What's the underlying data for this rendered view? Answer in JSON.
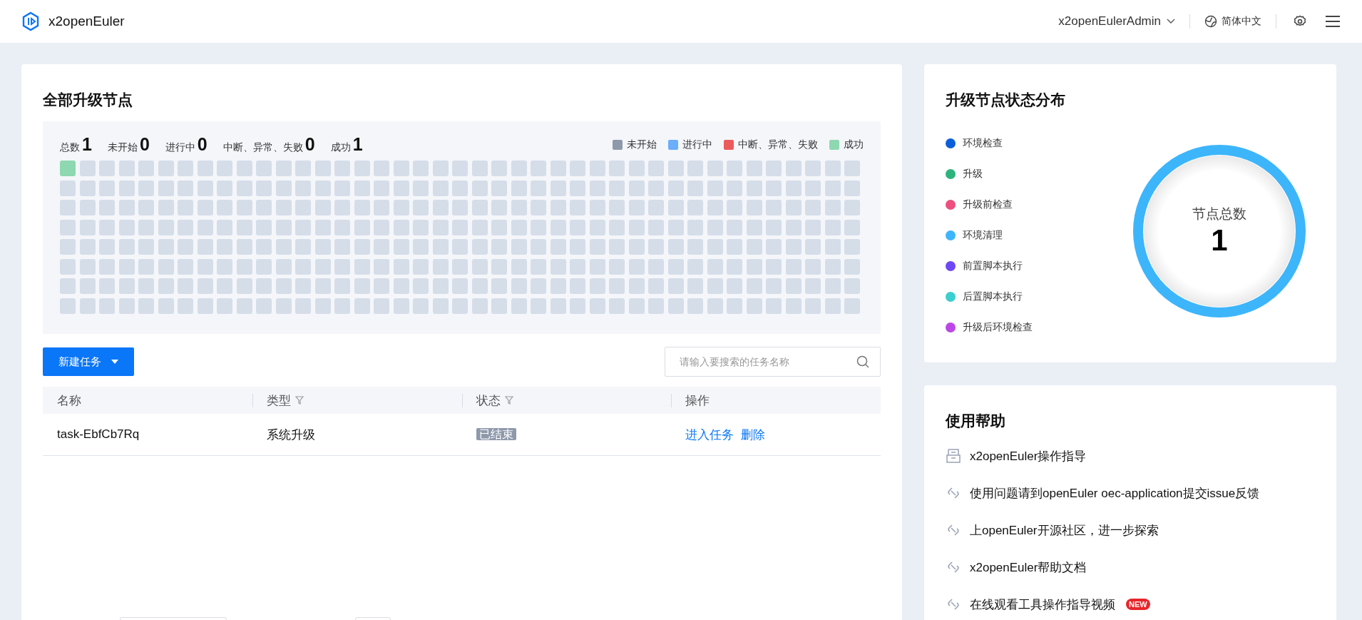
{
  "header": {
    "app_name": "x2openEuler",
    "user": "x2openEulerAdmin",
    "language": "简体中文"
  },
  "nodes_panel": {
    "title": "全部升级节点",
    "stats": [
      {
        "label": "总数",
        "value": "1"
      },
      {
        "label": "未开始",
        "value": "0"
      },
      {
        "label": "进行中",
        "value": "0"
      },
      {
        "label": "中断、异常、失败",
        "value": "0"
      },
      {
        "label": "成功",
        "value": "1"
      }
    ],
    "legend": [
      {
        "label": "未开始",
        "color": "#8e99ab"
      },
      {
        "label": "进行中",
        "color": "#6aaefc"
      },
      {
        "label": "中断、异常、失败",
        "color": "#ec5b5b"
      },
      {
        "label": "成功",
        "color": "#8dd8b0"
      }
    ],
    "nodes": [
      {
        "color": "#8dd8b0"
      }
    ]
  },
  "toolbar": {
    "new_task_button": "新建任务",
    "search": {
      "placeholder": "请输入要搜索的任务名称"
    }
  },
  "table": {
    "columns": [
      {
        "label": "名称",
        "filter": false
      },
      {
        "label": "类型",
        "filter": true
      },
      {
        "label": "状态",
        "filter": true
      },
      {
        "label": "操作",
        "filter": false
      }
    ],
    "rows": [
      {
        "name": "task-EbfCb7Rq",
        "type": "系统升级",
        "status": "已结束",
        "actions": [
          "进入任务",
          "删除"
        ]
      }
    ]
  },
  "status_panel": {
    "title": "升级节点状态分布",
    "legend": [
      {
        "label": "环境检查",
        "color": "#0b5fd8"
      },
      {
        "label": "升级",
        "color": "#2db37c"
      },
      {
        "label": "升级前检查",
        "color": "#ec4f80"
      },
      {
        "label": "环境清理",
        "color": "#3db5fb"
      },
      {
        "label": "前置脚本执行",
        "color": "#6d48f4"
      },
      {
        "label": "后置脚本执行",
        "color": "#3ccfcf"
      },
      {
        "label": "升级后环境检查",
        "color": "#bd47e6"
      }
    ],
    "center_label": "节点总数",
    "center_value": "1"
  },
  "help_panel": {
    "title": "使用帮助",
    "items": [
      {
        "kind": "doc",
        "text": "x2openEuler操作指导",
        "new": false
      },
      {
        "kind": "link",
        "text": "使用问题请到openEuler oec-application提交issue反馈",
        "new": false
      },
      {
        "kind": "link",
        "text": "上openEuler开源社区，进一步探索",
        "new": false
      },
      {
        "kind": "link",
        "text": "x2openEuler帮助文档",
        "new": false
      },
      {
        "kind": "link",
        "text": "在线观看工具操作指导视频",
        "new": true,
        "badge": "NEW"
      }
    ]
  }
}
